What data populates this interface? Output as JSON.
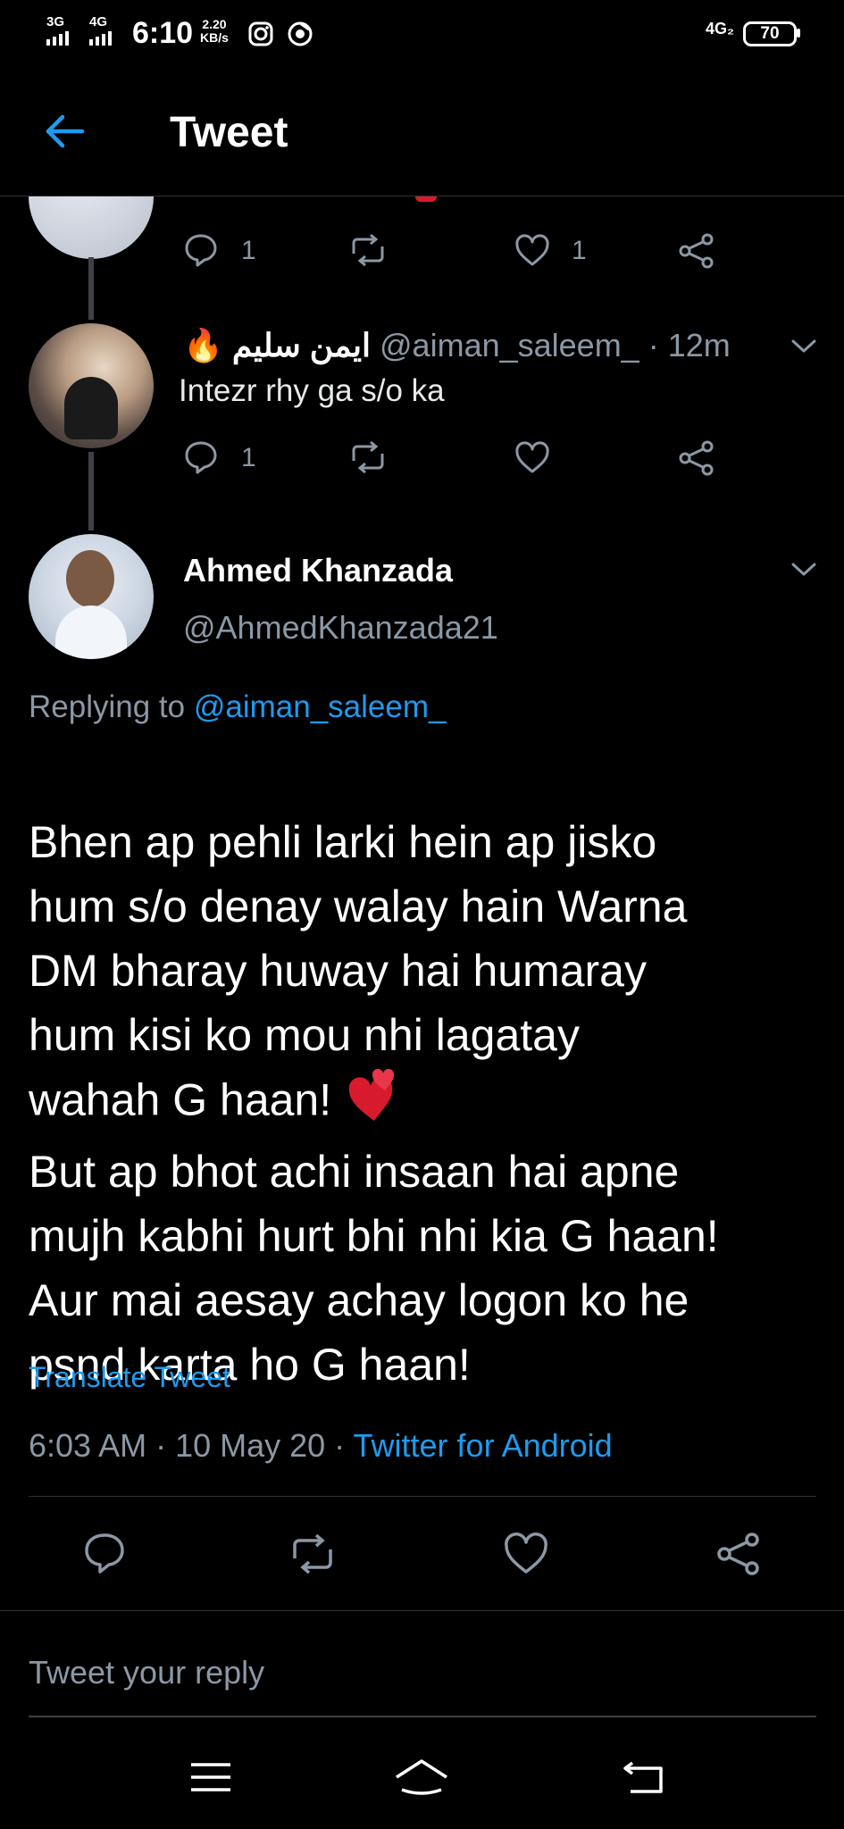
{
  "status_bar": {
    "sig1_label": "3G",
    "sig2_label": "4G",
    "time": "6:10",
    "speed_value": "2.20",
    "speed_unit": "KB/s",
    "net_label": "4G₂",
    "battery": "70"
  },
  "header": {
    "title": "Tweet",
    "back_icon": "arrow-left-icon"
  },
  "prev_tweet": {
    "reply_count": "1",
    "like_count": "1"
  },
  "reply_tweet": {
    "name": "ایمن سلیم",
    "emoji": "🔥",
    "handle": "@aiman_saleem_",
    "separator": "·",
    "time": "12m",
    "text": "Intezr rhy ga s/o ka",
    "reply_count": "1"
  },
  "main_tweet": {
    "name": "Ahmed Khanzada",
    "handle": "@AhmedKhanzada21",
    "replying_prefix": "Replying to",
    "replying_handle": "@aiman_saleem_",
    "body_part1": "Bhen ap pehli larki hein ap jisko\nhum s/o denay walay hain Warna\nDM bharay huway hai humaray\nhum kisi ko mou nhi lagatay\nwahah G haan!",
    "body_emoji": "💕",
    "body_part2": "But ap bhot achi insaan hai apne\nmujh kabhi hurt bhi nhi kia G haan!\nAur mai aesay achay logon ko he\npsnd karta ho G haan!",
    "translate": "Translate Tweet",
    "timestamp": "6:03 AM · 10 May 20 ·",
    "source": "Twitter for Android"
  },
  "reply_box": {
    "placeholder": "Tweet your reply"
  },
  "colors": {
    "accent": "#1d9bf0",
    "muted": "#8b98a5",
    "background": "#000000"
  }
}
